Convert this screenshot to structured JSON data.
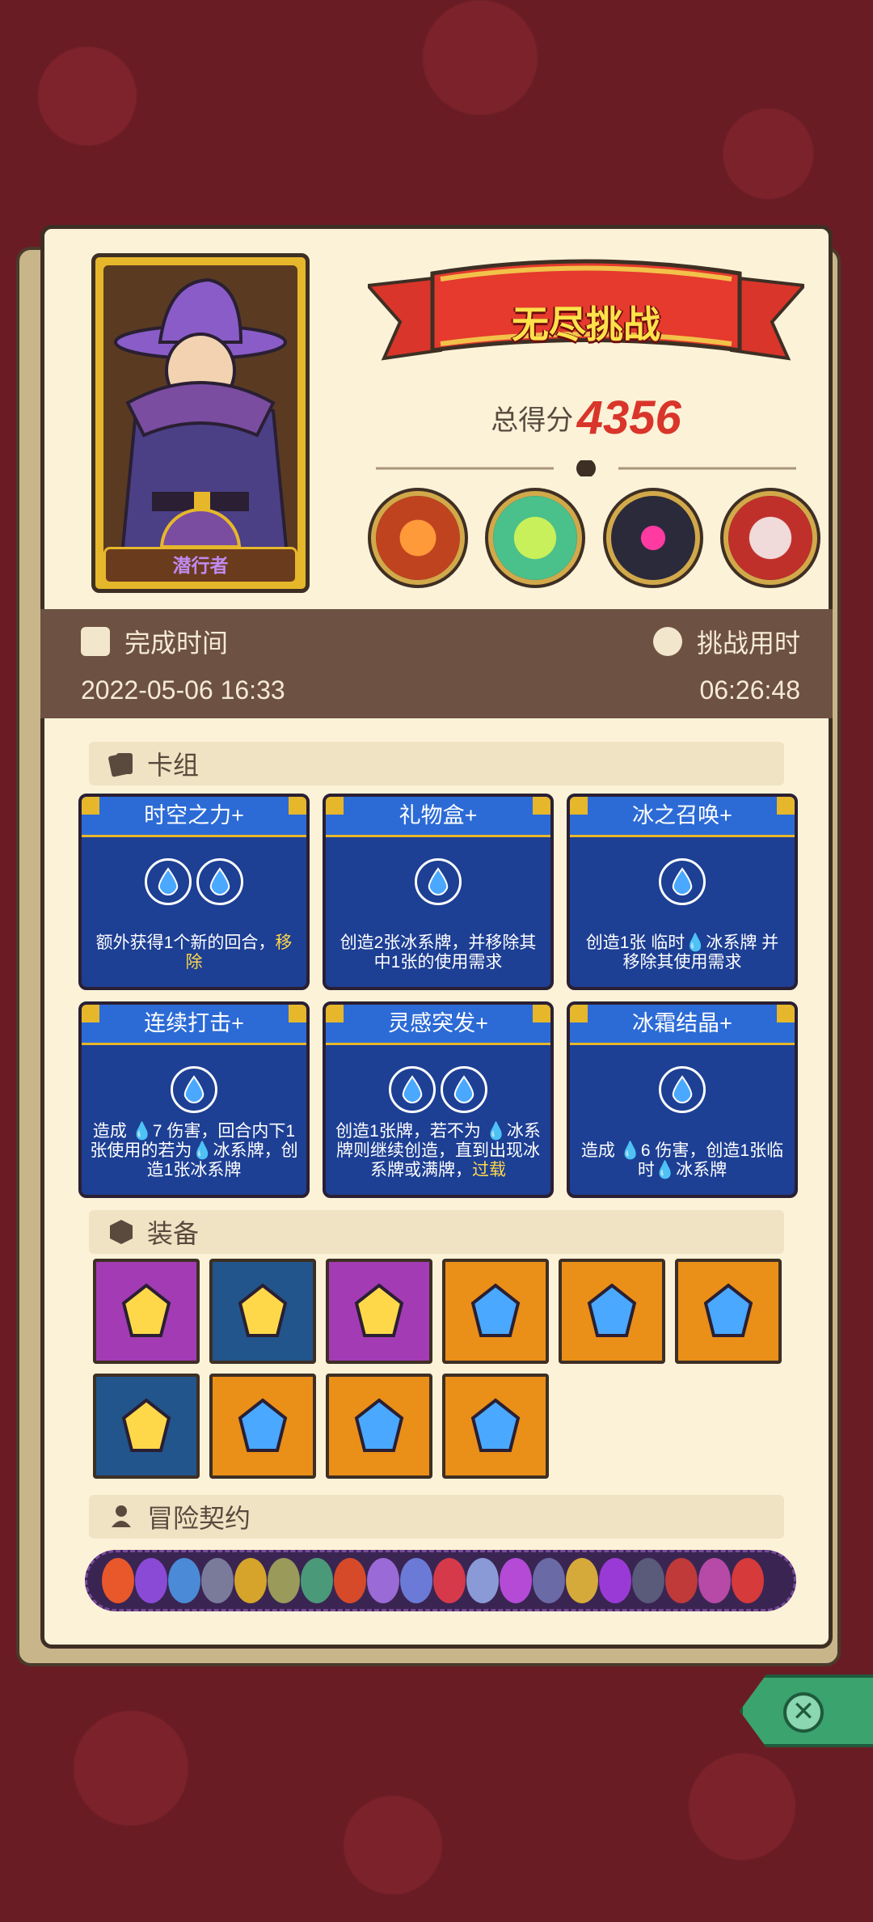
{
  "banner": {
    "title": "无尽挑战"
  },
  "score": {
    "label": "总得分",
    "value": "4356"
  },
  "hero": {
    "name": "潜行者"
  },
  "time": {
    "completed_label": "完成时间",
    "completed_value": "2022-05-06 16:33",
    "duration_label": "挑战用时",
    "duration_value": "06:26:48"
  },
  "sections": {
    "deck": "卡组",
    "equipment": "装备",
    "contracts": "冒险契约"
  },
  "cards": [
    {
      "title": "时空之力+",
      "cost": 2,
      "desc": "额外获得1个新的回合，",
      "desc_hl": "移除"
    },
    {
      "title": "礼物盒+",
      "cost": 1,
      "desc": "创造2张冰系牌，并移除其中1张的使用需求",
      "desc_hl": ""
    },
    {
      "title": "冰之召唤+",
      "cost": 1,
      "desc": "创造1张 临时💧冰系牌 并移除其使用需求",
      "desc_hl": ""
    },
    {
      "title": "连续打击+",
      "cost": 1,
      "desc": "造成 💧7 伤害，回合内下1张使用的若为💧冰系牌，创造1张冰系牌",
      "desc_hl": ""
    },
    {
      "title": "灵感突发+",
      "cost": 2,
      "desc": "创造1张牌，若不为 💧冰系牌则继续创造，直到出现冰系牌或满牌，",
      "desc_hl": "过载"
    },
    {
      "title": "冰霜结晶+",
      "cost": 1,
      "desc": "造成 💧6 伤害，创造1张临时💧冰系牌",
      "desc_hl": ""
    }
  ],
  "equipment": [
    {
      "icon": "gem-rune-icon",
      "color": "purple"
    },
    {
      "icon": "golden-helmet-icon",
      "color": "blue"
    },
    {
      "icon": "water-drop-icon",
      "color": "purple"
    },
    {
      "icon": "ice-sword-icon",
      "color": "orange"
    },
    {
      "icon": "ice-crystal-icon",
      "color": "orange"
    },
    {
      "icon": "blue-slime-icon",
      "color": "orange"
    },
    {
      "icon": "ice-medallion-icon",
      "color": "blue"
    },
    {
      "icon": "spiked-bracelet-icon",
      "color": "orange"
    },
    {
      "icon": "moss-stone-icon",
      "color": "orange"
    },
    {
      "icon": "pink-flame-icon",
      "color": "orange"
    }
  ],
  "contract_colors": [
    "#e8582a",
    "#8a4ad6",
    "#4a8ad6",
    "#7a7a9a",
    "#d6a42a",
    "#9a9a5a",
    "#4a9a7a",
    "#d64a2a",
    "#9a6ad6",
    "#6a7ad6",
    "#d63a4a",
    "#8a9ad6",
    "#b44ad6",
    "#6a6aa6",
    "#d6aa3a",
    "#9a3ad6",
    "#5a5a7a",
    "#c03a3a",
    "#b64aa6",
    "#d63a3a"
  ]
}
